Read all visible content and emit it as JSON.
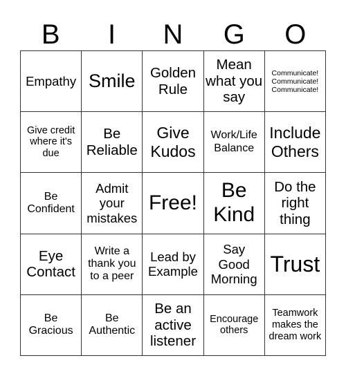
{
  "title_letters": [
    "B",
    "I",
    "N",
    "G",
    "O"
  ],
  "cells": [
    [
      "Empathy",
      "Smile",
      "Golden Rule",
      "Mean what you say",
      "Communicate! Communicate! Communicate!"
    ],
    [
      "Give credit where it's due",
      "Be Reliable",
      "Give Kudos",
      "Work/Life Balance",
      "Include Others"
    ],
    [
      "Be Confident",
      "Admit your mistakes",
      "Free!",
      "Be Kind",
      "Do the right thing"
    ],
    [
      "Eye Contact",
      "Write a thank you to a peer",
      "Lead by Example",
      "Say Good Morning",
      "Trust"
    ],
    [
      "Be Gracious",
      "Be Authentic",
      "Be an active listener",
      "Encourage others",
      "Teamwork makes the dream work"
    ]
  ]
}
